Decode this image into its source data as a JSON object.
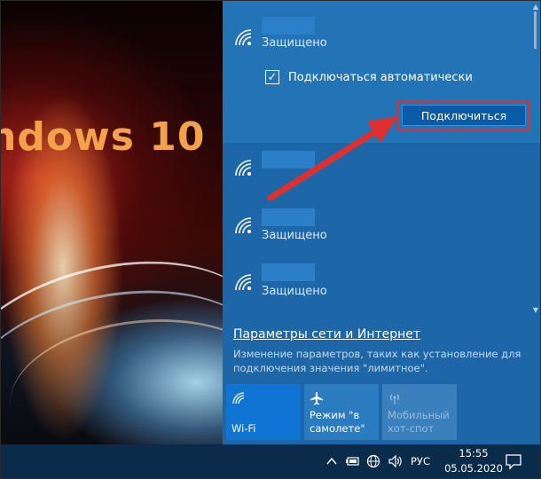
{
  "wallpaper": {
    "title_text": "ndows 10"
  },
  "flyout": {
    "selected_network": {
      "status": "Защищено",
      "auto_connect_label": "Подключаться автоматически",
      "auto_connect_checked": true,
      "connect_label": "Подключиться"
    },
    "networks": [
      {
        "status": ""
      },
      {
        "status": "Защищено"
      },
      {
        "status": "Защищено"
      }
    ],
    "settings_link": "Параметры сети и Интернет",
    "settings_desc": "Изменение параметров, таких как установление для подключения значения \"лимитное\".",
    "tiles": [
      {
        "label": "Wi-Fi",
        "icon": "wifi-icon",
        "active": true
      },
      {
        "label": "Режим \"в самолете\"",
        "icon": "airplane-icon",
        "active": false
      },
      {
        "label": "Мобильный хот-спот",
        "icon": "hotspot-icon",
        "active": false,
        "disabled": true
      }
    ]
  },
  "taskbar": {
    "language": "РУС",
    "time": "15:55",
    "date": "05.05.2020",
    "icons": [
      "chevron-up-icon",
      "battery-icon",
      "network-globe-icon",
      "volume-icon",
      "notification-icon"
    ]
  },
  "colors": {
    "flyout_bg": "#1d67a8",
    "selected_bg": "#2373b7",
    "connect_button": "#0a5ca8",
    "annotation_red": "#e02f2f",
    "taskbar_bg": "#0b2b4a",
    "tile_active": "#0f74d3"
  }
}
